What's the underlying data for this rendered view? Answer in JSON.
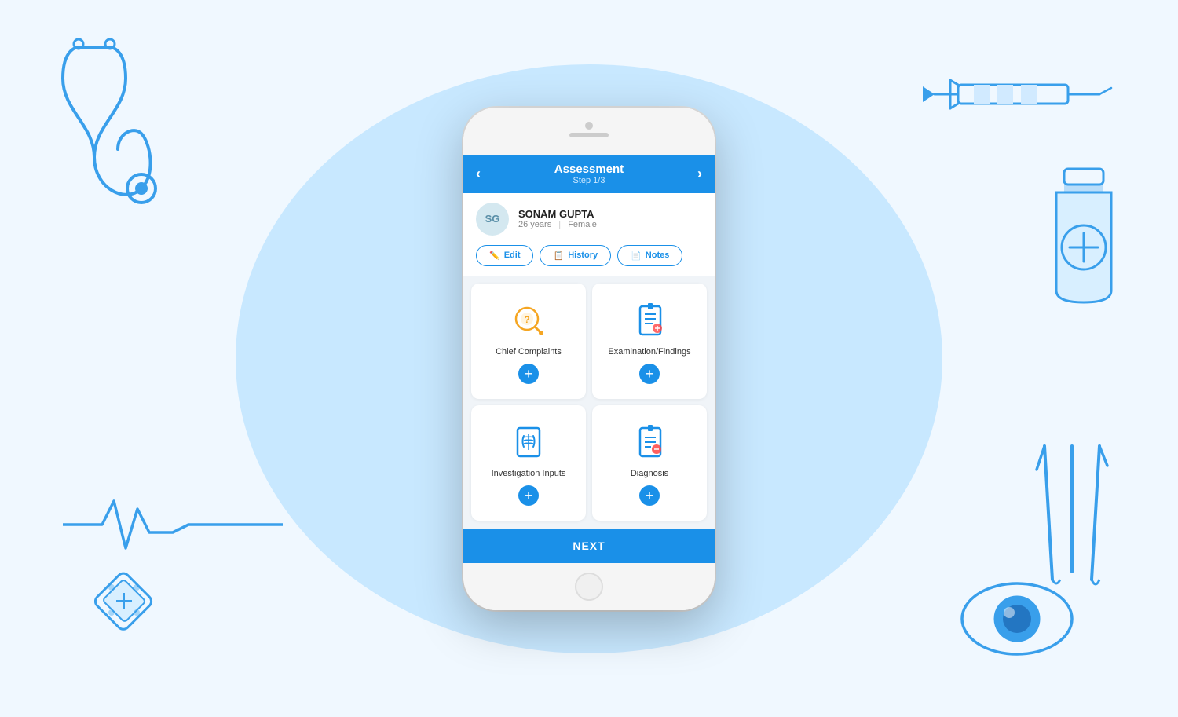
{
  "background": {
    "blob_color": "#c8e8ff"
  },
  "phone": {
    "header": {
      "title": "Assessment",
      "step": "Step 1/3",
      "back_arrow": "<",
      "forward_arrow": ">"
    },
    "patient": {
      "initials": "SG",
      "name": "SONAM GUPTA",
      "age": "26 years",
      "gender": "Female"
    },
    "action_buttons": [
      {
        "id": "edit",
        "icon": "✏️",
        "label": "Edit"
      },
      {
        "id": "history",
        "icon": "📋",
        "label": "History"
      },
      {
        "id": "notes",
        "icon": "📄",
        "label": "Notes"
      }
    ],
    "grid_cards": [
      {
        "id": "chief-complaints",
        "label": "Chief Complaints",
        "icon": "search-question"
      },
      {
        "id": "examination-findings",
        "label": "Examination/Findings",
        "icon": "clipboard-chart"
      },
      {
        "id": "investigation-inputs",
        "label": "Investigation Inputs",
        "icon": "xray"
      },
      {
        "id": "diagnosis",
        "label": "Diagnosis",
        "icon": "clipboard-cross"
      }
    ],
    "next_button": "NEXT"
  }
}
